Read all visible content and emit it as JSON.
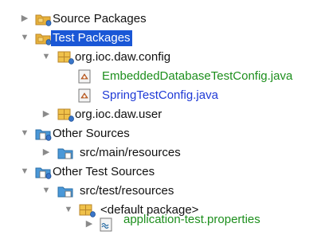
{
  "tree": {
    "items": [
      {
        "label": "Source Packages",
        "expanded": false,
        "icon": "source-packages-folder-icon",
        "color": "#111111"
      },
      {
        "label": "Test Packages",
        "expanded": true,
        "selected": true,
        "icon": "test-packages-folder-icon",
        "color": "#ffffff"
      },
      {
        "label": "org.ioc.daw.config",
        "expanded": true,
        "icon": "package-icon",
        "color": "#111111"
      },
      {
        "label": "EmbeddedDatabaseTestConfig.java",
        "icon": "java-file-icon",
        "color": "#1d8f1d"
      },
      {
        "label": "SpringTestConfig.java",
        "icon": "java-file-icon",
        "color": "#1f3ad6"
      },
      {
        "label": "org.ioc.daw.user",
        "expanded": false,
        "icon": "package-icon",
        "color": "#111111"
      },
      {
        "label": "Other Sources",
        "expanded": true,
        "icon": "other-sources-folder-icon",
        "color": "#111111"
      },
      {
        "label": "src/main/resources",
        "expanded": false,
        "icon": "folder-icon",
        "color": "#111111"
      },
      {
        "label": "Other Test Sources",
        "expanded": true,
        "icon": "other-sources-folder-icon",
        "color": "#111111"
      },
      {
        "label": "src/test/resources",
        "expanded": true,
        "icon": "folder-icon",
        "color": "#111111"
      },
      {
        "label": "<default package>",
        "expanded": true,
        "icon": "package-icon",
        "color": "#111111"
      },
      {
        "label": "application-test.properties",
        "expanded": false,
        "icon": "properties-file-icon",
        "color": "#1d8f1d"
      }
    ]
  },
  "colors": {
    "selection": "#1a57d6",
    "modified_file": "#1d8f1d",
    "new_file": "#1f3ad6"
  }
}
